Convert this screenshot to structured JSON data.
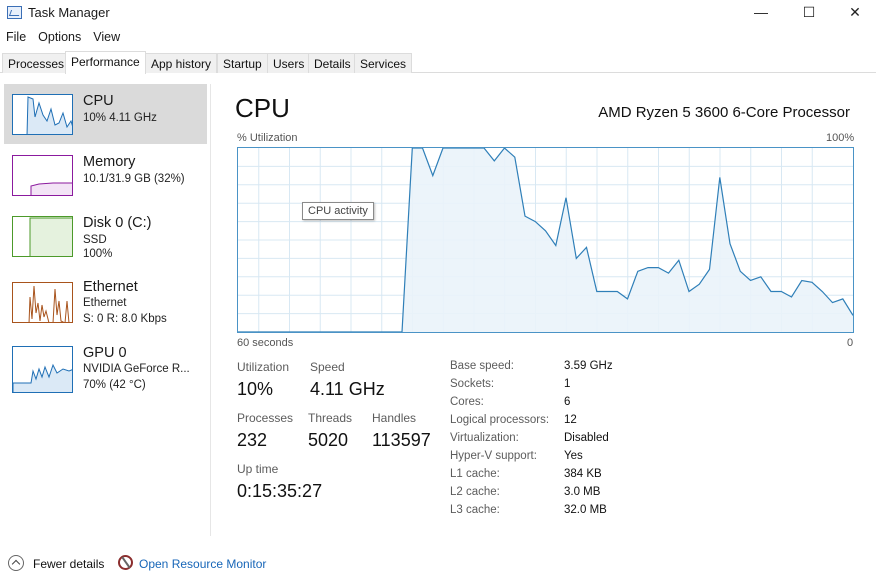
{
  "window": {
    "title": "Task Manager",
    "icon": "task-manager-icon",
    "controls": {
      "minimize": "—",
      "maximize": "☐",
      "close": "✕"
    }
  },
  "menu": [
    "File",
    "Options",
    "View"
  ],
  "tabs": [
    "Processes",
    "Performance",
    "App history",
    "Startup",
    "Users",
    "Details",
    "Services"
  ],
  "active_tab": "Performance",
  "sidebar": {
    "items": [
      {
        "title": "CPU",
        "line1": "10% 4.11 GHz",
        "line2": "",
        "color": "#1f6fb5",
        "active": true
      },
      {
        "title": "Memory",
        "line1": "10.1/31.9 GB (32%)",
        "line2": "",
        "color": "#8b1a9e"
      },
      {
        "title": "Disk 0 (C:)",
        "line1": "SSD",
        "line2": "100%",
        "color": "#4c9a2a"
      },
      {
        "title": "Ethernet",
        "line1": "Ethernet",
        "line2": "S: 0 R: 8.0 Kbps",
        "color": "#a8531c"
      },
      {
        "title": "GPU 0",
        "line1": "NVIDIA GeForce R...",
        "line2": "70% (42 °C)",
        "color": "#1f6fb5"
      }
    ]
  },
  "main": {
    "title": "CPU",
    "model": "AMD Ryzen 5 3600 6-Core Processor",
    "graph": {
      "y_label": "% Utilization",
      "y_max_label": "100%",
      "x_left_label": "60 seconds",
      "x_right_label": "0",
      "tooltip": "CPU activity",
      "line_color": "#2f7fb8",
      "fill_color": "#eaf3fa",
      "grid_color": "#d8e8f3"
    },
    "stats": {
      "utilization_label": "Utilization",
      "utilization": "10%",
      "speed_label": "Speed",
      "speed": "4.11 GHz",
      "processes_label": "Processes",
      "processes": "232",
      "threads_label": "Threads",
      "threads": "5020",
      "handles_label": "Handles",
      "handles": "113597",
      "uptime_label": "Up time",
      "uptime": "0:15:35:27"
    },
    "info": [
      {
        "label": "Base speed:",
        "value": "3.59 GHz"
      },
      {
        "label": "Sockets:",
        "value": "1"
      },
      {
        "label": "Cores:",
        "value": "6"
      },
      {
        "label": "Logical processors:",
        "value": "12"
      },
      {
        "label": "Virtualization:",
        "value": "Disabled"
      },
      {
        "label": "Hyper-V support:",
        "value": "Yes"
      },
      {
        "label": "L1 cache:",
        "value": "384 KB"
      },
      {
        "label": "L2 cache:",
        "value": "3.0 MB"
      },
      {
        "label": "L3 cache:",
        "value": "32.0 MB"
      }
    ]
  },
  "footer": {
    "fewer_details": "Fewer details",
    "open_resource_monitor": "Open Resource Monitor"
  },
  "chart_data": {
    "type": "area",
    "ylabel": "% Utilization",
    "ylim": [
      0,
      100
    ],
    "x_range_seconds": [
      60,
      0
    ],
    "grid": true,
    "series": [
      {
        "values": [
          0,
          0,
          0,
          0,
          0,
          0,
          0,
          0,
          0,
          0,
          0,
          0,
          0,
          0,
          0,
          0,
          0,
          100,
          100,
          85,
          100,
          100,
          100,
          100,
          100,
          93,
          100,
          95,
          63,
          60,
          55,
          47,
          73,
          40,
          46,
          22,
          22,
          22,
          18,
          33,
          35,
          35,
          32,
          39,
          22,
          26,
          34,
          84,
          48,
          33,
          28,
          30,
          22,
          22,
          19,
          28,
          27,
          22,
          16,
          18,
          9
        ]
      }
    ]
  }
}
